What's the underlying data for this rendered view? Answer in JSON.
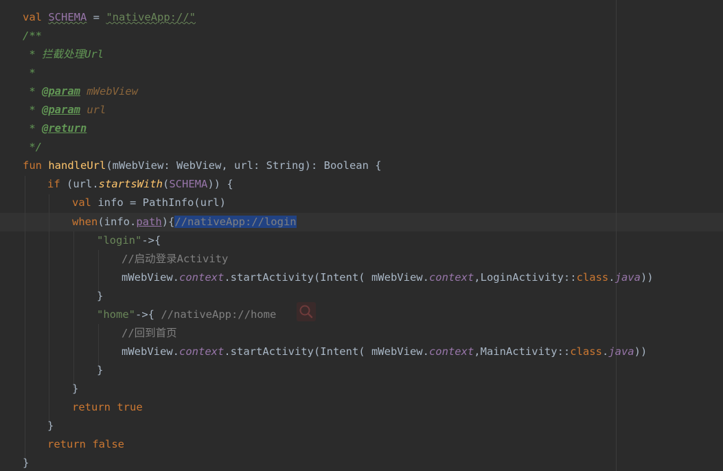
{
  "code": {
    "l1": {
      "kw": "val",
      "name": "SCHEMA",
      "eq": " = ",
      "str": "\"nativeApp://\""
    },
    "l2": "/**",
    "l3": " * 拦截处理Url",
    "l4": " *",
    "l5": {
      "prefix": " * ",
      "tag": "@param",
      "param": "mWebView"
    },
    "l6": {
      "prefix": " * ",
      "tag": "@param",
      "param": "url"
    },
    "l7": {
      "prefix": " * ",
      "tag": "@return"
    },
    "l8": " */",
    "l9": {
      "kw": "fun",
      "name": "handleUrl",
      "sig": "(mWebView: WebView, url: String): Boolean {"
    },
    "l10": {
      "kw": "if",
      "open": " (url.",
      "ext": "startsWith",
      "mid": "(",
      "ref": "SCHEMA",
      "close": ")) {"
    },
    "l11": {
      "kw": "val",
      "rest": " info = PathInfo(url)"
    },
    "l12": {
      "kw": "when",
      "open": "(info.",
      "path": "path",
      "close": "){",
      "comment": "//nativeApp://login"
    },
    "l13": {
      "str": "\"login\"",
      "rest": "->{"
    },
    "l14": "//启动登录Activity",
    "l15": {
      "a": "mWebView.",
      "ctx": "context",
      "b": ".startActivity(Intent( mWebView.",
      "ctx2": "context",
      "c": ",LoginActivity::",
      "cls": "class",
      "d": ".",
      "java": "java",
      "e": "))"
    },
    "l16": "}",
    "l17": {
      "str": "\"home\"",
      "rest": "->{ ",
      "comment": "//nativeApp://home"
    },
    "l18": "//回到首页",
    "l19": {
      "a": "mWebView.",
      "ctx": "context",
      "b": ".startActivity(Intent( mWebView.",
      "ctx2": "context",
      "c": ",MainActivity::",
      "cls": "class",
      "d": ".",
      "java": "java",
      "e": "))"
    },
    "l20": "}",
    "l21": "}",
    "l22": {
      "kw": "return",
      "val": "true"
    },
    "l23": "}",
    "l24": {
      "kw": "return",
      "val": "false"
    },
    "l25": "}"
  },
  "icons": {
    "search_hint": "search-icon"
  },
  "colors": {
    "background": "#2b2b2b",
    "keyword": "#cc7832",
    "string": "#6a8759",
    "comment": "#808080",
    "doc_comment": "#629755",
    "property": "#9876aa",
    "function": "#ffc66d",
    "selection": "#214283"
  }
}
